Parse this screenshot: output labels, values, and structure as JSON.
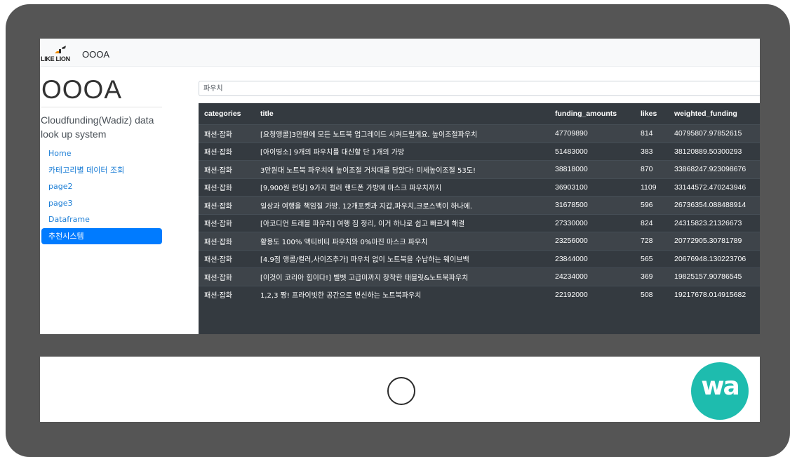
{
  "navbar": {
    "logo_text": "LIKE LION",
    "brand": "OOOA"
  },
  "sidebar": {
    "title": "OOOA",
    "description": "Cloudfunding(Wadiz) data look up system",
    "items": [
      {
        "label": "Home"
      },
      {
        "label": "카테고리별 데이터 조회"
      },
      {
        "label": "page2"
      },
      {
        "label": "page3"
      },
      {
        "label": "Dataframe"
      },
      {
        "label": "추천시스템"
      }
    ],
    "active_index": 5
  },
  "search": {
    "value": "파우치"
  },
  "table": {
    "headers": [
      "categories",
      "title",
      "funding_amounts",
      "likes",
      "weighted_funding"
    ],
    "rows": [
      [
        "패션·잡화",
        "[요청앵콜]3만원에 모든 노트북 업그레이드 시켜드릴게요. 높이조절파우치",
        "47709890",
        "814",
        "40795807.97852615"
      ],
      [
        "패션·잡화",
        "[아이띵소] 9개의 파우치를 대신할 단 1개의 가방",
        "51483000",
        "383",
        "38120889.50300293"
      ],
      [
        "패션·잡화",
        "3만원대 노트북 파우치에 높이조절 거치대를 담았다! 미세높이조절 53도!",
        "38818000",
        "870",
        "33868247.923098676"
      ],
      [
        "패션·잡화",
        "[9,900원 펀딩] 9가지 컬러 핸드폰 가방에 마스크 파우치까지",
        "36903100",
        "1109",
        "33144572.470243946"
      ],
      [
        "패션·잡화",
        "일상과 여행을 책임질 가방. 12개포켓과 지갑,파우치,크로스백이 하나에.",
        "31678500",
        "596",
        "26736354.088488914"
      ],
      [
        "패션·잡화",
        "[아코디언 트래블 파우치] 여행 짐 정리, 이거 하나로 쉽고 빠르게 해결",
        "27330000",
        "824",
        "24315823.21326673"
      ],
      [
        "패션·잡화",
        "활용도 100% 액티비티 파우치와 0%마진 마스크 파우치",
        "23256000",
        "728",
        "20772905.30781789"
      ],
      [
        "패션·잡화",
        "[4.9점 앵콜/컬러,사이즈추가] 파우치 없이 노트북을 수납하는 웨이브백",
        "23844000",
        "565",
        "20676948.130223706"
      ],
      [
        "패션·잡화",
        "[이것이 코리아 힙이다!] 벨벳 고급미까지 장착한 태블릿&노트북파우치",
        "24234000",
        "369",
        "19825157.90786545"
      ],
      [
        "패션·잡화",
        "1,2,3 짱! 프라이빗한 공간으로 변신하는 노트북파우치",
        "22192000",
        "508",
        "19217678.014915682"
      ]
    ]
  },
  "device": {
    "badge_text": "wa",
    "badge_color": "#1ebcae",
    "frame_color": "#555555"
  }
}
